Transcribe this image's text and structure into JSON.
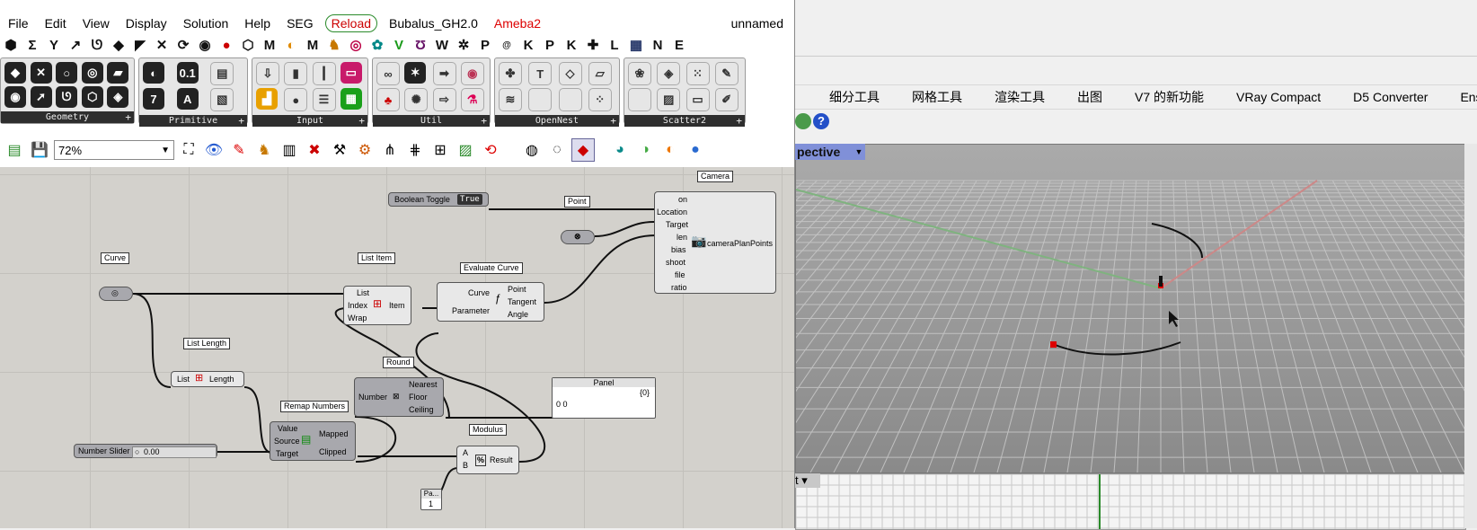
{
  "menubar": {
    "items": [
      "File",
      "Edit",
      "View",
      "Display",
      "Solution",
      "Help",
      "SEG",
      "Reload",
      "Bubalus_GH2.0",
      "Ameba2"
    ],
    "document_name": "unnamed"
  },
  "tabs": [
    "Σ",
    "M",
    "M",
    "V",
    "W",
    "P",
    "K",
    "P",
    "K",
    "L",
    "N",
    "E"
  ],
  "ribbon": {
    "panels": [
      "Geometry",
      "Primitive",
      "Input",
      "Util",
      "OpenNest",
      "Scatter2"
    ]
  },
  "canvas_toolbar": {
    "zoom": "72%"
  },
  "canvas": {
    "components": {
      "boolean_toggle": {
        "name": "Boolean Toggle",
        "value": "True"
      },
      "point": {
        "label": "Point"
      },
      "camera": {
        "label": "Camera",
        "inputs": [
          "on",
          "Location",
          "Target",
          "len",
          "bias",
          "shoot",
          "file",
          "ratio"
        ],
        "output": "cameraPlanPoints"
      },
      "curve": {
        "label": "Curve"
      },
      "list_item": {
        "label": "List Item",
        "inputs": [
          "List",
          "Index",
          "Wrap"
        ],
        "output": "Item"
      },
      "evaluate_curve": {
        "label": "Evaluate Curve",
        "inputs": [
          "Curve",
          "Parameter"
        ],
        "outputs": [
          "Point",
          "Tangent",
          "Angle"
        ]
      },
      "list_length": {
        "label": "List Length",
        "input": "List",
        "output": "Length"
      },
      "round": {
        "label": "Round",
        "input": "Number",
        "outputs": [
          "Nearest",
          "Floor",
          "Ceiling"
        ]
      },
      "panel": {
        "title": "Panel",
        "path": "{0}",
        "content": "0  0"
      },
      "remap_numbers": {
        "label": "Remap Numbers",
        "inputs": [
          "Value",
          "Source",
          "Target"
        ],
        "outputs": [
          "Mapped",
          "Clipped"
        ]
      },
      "number_slider": {
        "name": "Number Slider",
        "value": "0.00"
      },
      "modulus": {
        "label": "Modulus",
        "inputs": [
          "A",
          "B"
        ],
        "output": "Result"
      },
      "small_panel": {
        "title": "Pa...",
        "content": "1"
      }
    }
  },
  "rhino": {
    "tabs": [
      "细分工具",
      "网格工具",
      "渲染工具",
      "出图",
      "V7 的新功能",
      "VRay Compact",
      "D5 Converter",
      "Ens"
    ],
    "viewport_title": "pective",
    "bottom_viewport_title": "t"
  }
}
